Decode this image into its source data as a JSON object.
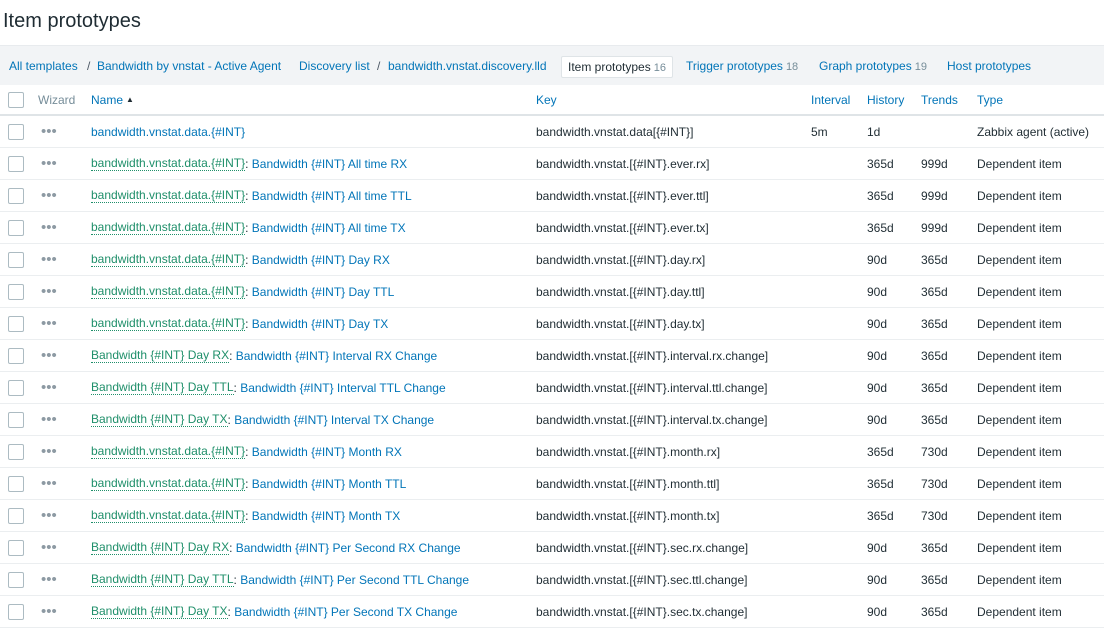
{
  "page": {
    "title": "Item prototypes"
  },
  "breadcrumbs": {
    "all_templates": "All templates",
    "template": "Bandwidth by vnstat - Active Agent",
    "discovery_list": "Discovery list",
    "discovery_rule": "bandwidth.vnstat.discovery.lld",
    "tabs": [
      {
        "label": "Item prototypes",
        "count": "16"
      },
      {
        "label": "Trigger prototypes",
        "count": "18"
      },
      {
        "label": "Graph prototypes",
        "count": "19"
      },
      {
        "label": "Host prototypes",
        "count": ""
      }
    ]
  },
  "table": {
    "headers": {
      "wizard": "Wizard",
      "name": "Name",
      "key": "Key",
      "interval": "Interval",
      "history": "History",
      "trends": "Trends",
      "type": "Type"
    },
    "rows": [
      {
        "parent": "",
        "name": "bandwidth.vnstat.data.{#INT}",
        "key": "bandwidth.vnstat.data[{#INT}]",
        "interval": "5m",
        "history": "1d",
        "trends": "",
        "type": "Zabbix agent (active)"
      },
      {
        "parent": "bandwidth.vnstat.data.{#INT}",
        "name": "Bandwidth {#INT} All time RX",
        "key": "bandwidth.vnstat.[{#INT}.ever.rx]",
        "interval": "",
        "history": "365d",
        "trends": "999d",
        "type": "Dependent item"
      },
      {
        "parent": "bandwidth.vnstat.data.{#INT}",
        "name": "Bandwidth {#INT} All time TTL",
        "key": "bandwidth.vnstat.[{#INT}.ever.ttl]",
        "interval": "",
        "history": "365d",
        "trends": "999d",
        "type": "Dependent item"
      },
      {
        "parent": "bandwidth.vnstat.data.{#INT}",
        "name": "Bandwidth {#INT} All time TX",
        "key": "bandwidth.vnstat.[{#INT}.ever.tx]",
        "interval": "",
        "history": "365d",
        "trends": "999d",
        "type": "Dependent item"
      },
      {
        "parent": "bandwidth.vnstat.data.{#INT}",
        "name": "Bandwidth {#INT} Day RX",
        "key": "bandwidth.vnstat.[{#INT}.day.rx]",
        "interval": "",
        "history": "90d",
        "trends": "365d",
        "type": "Dependent item"
      },
      {
        "parent": "bandwidth.vnstat.data.{#INT}",
        "name": "Bandwidth {#INT} Day TTL",
        "key": "bandwidth.vnstat.[{#INT}.day.ttl]",
        "interval": "",
        "history": "90d",
        "trends": "365d",
        "type": "Dependent item"
      },
      {
        "parent": "bandwidth.vnstat.data.{#INT}",
        "name": "Bandwidth {#INT} Day TX",
        "key": "bandwidth.vnstat.[{#INT}.day.tx]",
        "interval": "",
        "history": "90d",
        "trends": "365d",
        "type": "Dependent item"
      },
      {
        "parent": "Bandwidth {#INT} Day RX",
        "name": "Bandwidth {#INT} Interval RX Change",
        "key": "bandwidth.vnstat.[{#INT}.interval.rx.change]",
        "interval": "",
        "history": "90d",
        "trends": "365d",
        "type": "Dependent item"
      },
      {
        "parent": "Bandwidth {#INT} Day TTL",
        "name": "Bandwidth {#INT} Interval TTL Change",
        "key": "bandwidth.vnstat.[{#INT}.interval.ttl.change]",
        "interval": "",
        "history": "90d",
        "trends": "365d",
        "type": "Dependent item"
      },
      {
        "parent": "Bandwidth {#INT} Day TX",
        "name": "Bandwidth {#INT} Interval TX Change",
        "key": "bandwidth.vnstat.[{#INT}.interval.tx.change]",
        "interval": "",
        "history": "90d",
        "trends": "365d",
        "type": "Dependent item"
      },
      {
        "parent": "bandwidth.vnstat.data.{#INT}",
        "name": "Bandwidth {#INT} Month RX",
        "key": "bandwidth.vnstat.[{#INT}.month.rx]",
        "interval": "",
        "history": "365d",
        "trends": "730d",
        "type": "Dependent item"
      },
      {
        "parent": "bandwidth.vnstat.data.{#INT}",
        "name": "Bandwidth {#INT} Month TTL",
        "key": "bandwidth.vnstat.[{#INT}.month.ttl]",
        "interval": "",
        "history": "365d",
        "trends": "730d",
        "type": "Dependent item"
      },
      {
        "parent": "bandwidth.vnstat.data.{#INT}",
        "name": "Bandwidth {#INT} Month TX",
        "key": "bandwidth.vnstat.[{#INT}.month.tx]",
        "interval": "",
        "history": "365d",
        "trends": "730d",
        "type": "Dependent item"
      },
      {
        "parent": "Bandwidth {#INT} Day RX",
        "name": "Bandwidth {#INT} Per Second RX Change",
        "key": "bandwidth.vnstat.[{#INT}.sec.rx.change]",
        "interval": "",
        "history": "90d",
        "trends": "365d",
        "type": "Dependent item"
      },
      {
        "parent": "Bandwidth {#INT} Day TTL",
        "name": "Bandwidth {#INT} Per Second TTL Change",
        "key": "bandwidth.vnstat.[{#INT}.sec.ttl.change]",
        "interval": "",
        "history": "90d",
        "trends": "365d",
        "type": "Dependent item"
      },
      {
        "parent": "Bandwidth {#INT} Day TX",
        "name": "Bandwidth {#INT} Per Second TX Change",
        "key": "bandwidth.vnstat.[{#INT}.sec.tx.change]",
        "interval": "",
        "history": "90d",
        "trends": "365d",
        "type": "Dependent item"
      }
    ]
  }
}
